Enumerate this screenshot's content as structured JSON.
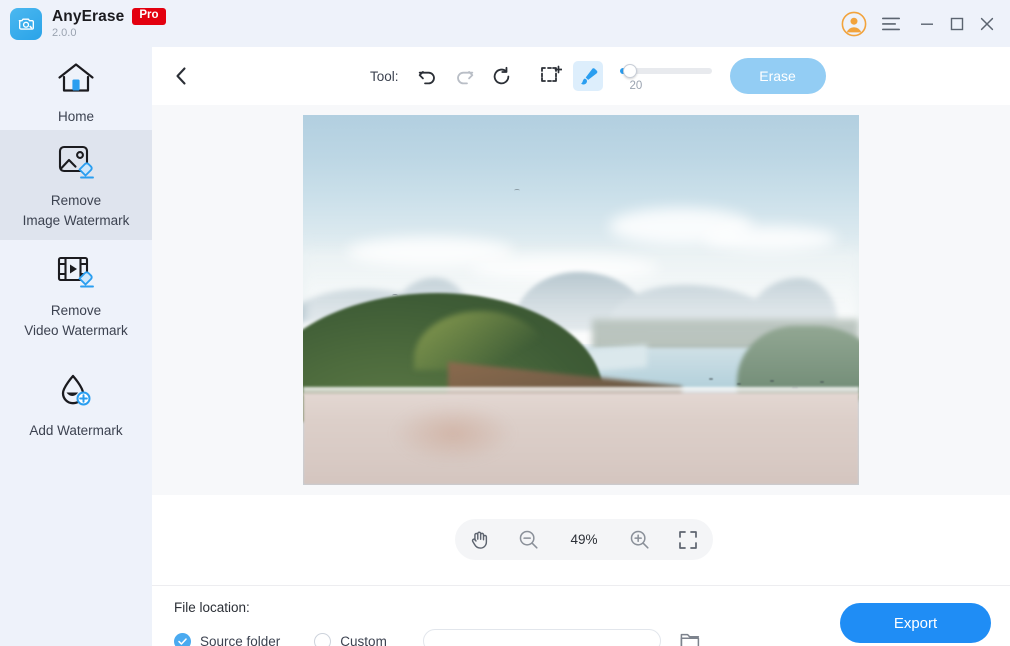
{
  "titlebar": {
    "app_name": "AnyErase",
    "pro_badge": "Pro",
    "version": "2.0.0",
    "icons": {
      "logo": "camera-logo-icon",
      "account": "user-account-icon",
      "menu": "hamburger-menu-icon",
      "minimize": "minimize-icon",
      "maximize": "maximize-icon",
      "close": "close-icon"
    },
    "colors": {
      "background": "#eef2fa",
      "pro_badge_bg": "#e3000f",
      "logo_blue": "#2aa3e8",
      "avatar_orange": "#f2a33c"
    }
  },
  "sidebar": {
    "background": "#eef2fa",
    "active_background": "#dfe4ee",
    "items": [
      {
        "id": "home",
        "label": "Home",
        "icon": "home-icon",
        "active": false
      },
      {
        "id": "remove-image-watermark",
        "label": "Remove\nImage Watermark",
        "icon": "image-eraser-icon",
        "active": true
      },
      {
        "id": "remove-video-watermark",
        "label": "Remove\nVideo Watermark",
        "icon": "video-eraser-icon",
        "active": false
      },
      {
        "id": "add-watermark",
        "label": "Add Watermark",
        "icon": "droplet-plus-icon",
        "active": false
      }
    ]
  },
  "toolbar": {
    "back_icon": "chevron-left-icon",
    "tool_label": "Tool:",
    "tools": [
      {
        "id": "undo",
        "icon": "undo-icon",
        "enabled": true,
        "selected": false,
        "color": "#2b2f36"
      },
      {
        "id": "redo",
        "icon": "redo-icon",
        "enabled": false,
        "selected": false,
        "color": "#b9bec6"
      },
      {
        "id": "reset",
        "icon": "reset-icon",
        "enabled": true,
        "selected": false,
        "color": "#2b2f36"
      },
      {
        "id": "selection",
        "icon": "marquee-add-icon",
        "enabled": true,
        "selected": false,
        "color": "#2b2f36"
      },
      {
        "id": "brush",
        "icon": "brush-icon",
        "enabled": true,
        "selected": true,
        "color": "#2a9ef0"
      }
    ],
    "brush_size": {
      "value": "20",
      "min": 1,
      "max": 100,
      "percent": 10
    },
    "erase_button": {
      "label": "Erase",
      "enabled": false,
      "color": "#93cdf4"
    }
  },
  "canvas": {
    "background": "#f7f8fa",
    "image_alt": "coastal landscape with green hill, hazy mountains and bay"
  },
  "zoombar": {
    "pan_icon": "hand-pan-icon",
    "zoom_out_icon": "zoom-out-icon",
    "zoom_level": "49%",
    "zoom_in_icon": "zoom-in-icon",
    "fit_screen_icon": "fit-to-screen-icon"
  },
  "bottom": {
    "file_location_label": "File location:",
    "options": [
      {
        "id": "source-folder",
        "label": "Source folder",
        "selected": true
      },
      {
        "id": "custom",
        "label": "Custom",
        "selected": false
      }
    ],
    "custom_path": {
      "value": "",
      "placeholder": ""
    },
    "browse_icon": "folder-icon",
    "export_button": {
      "label": "Export",
      "color": "#1f8df5"
    }
  }
}
